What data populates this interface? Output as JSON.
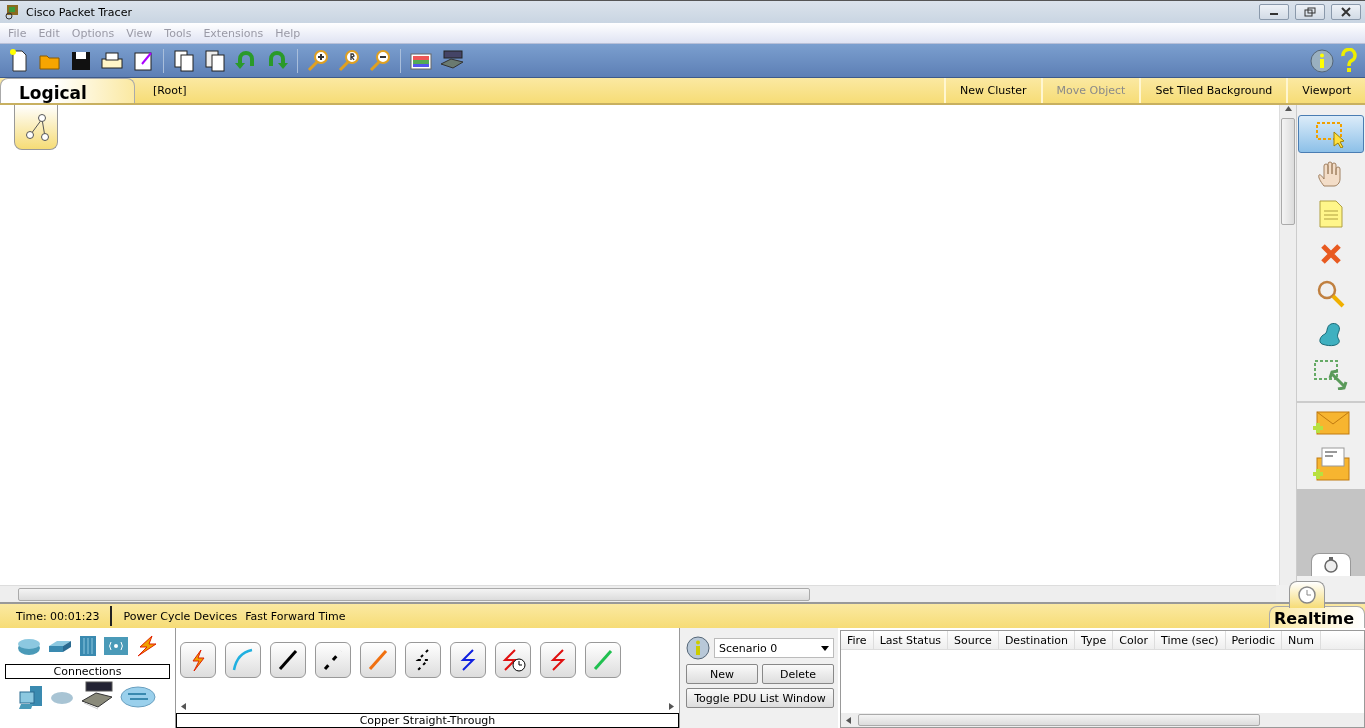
{
  "window": {
    "title": "Cisco Packet Tracer"
  },
  "menu": [
    "File",
    "Edit",
    "Options",
    "View",
    "Tools",
    "Extensions",
    "Help"
  ],
  "workspace_bar": {
    "tab": "Logical",
    "path": "[Root]",
    "actions": [
      {
        "label": "New Cluster",
        "disabled": false
      },
      {
        "label": "Move Object",
        "disabled": true
      },
      {
        "label": "Set Tiled Background",
        "disabled": false
      },
      {
        "label": "Viewport",
        "disabled": false
      }
    ]
  },
  "tools": [
    {
      "kind": "select",
      "selected": true
    },
    {
      "kind": "hand",
      "selected": false
    },
    {
      "kind": "note",
      "selected": false
    },
    {
      "kind": "delete",
      "selected": false
    },
    {
      "kind": "inspect",
      "selected": false
    },
    {
      "kind": "shape",
      "selected": false
    },
    {
      "kind": "resize",
      "selected": false
    },
    {
      "kind": "simple-pdu",
      "selected": false
    },
    {
      "kind": "complex-pdu",
      "selected": false
    }
  ],
  "status_bar": {
    "time": "Time: 00:01:23",
    "actions": [
      "Power Cycle Devices",
      "Fast Forward Time"
    ],
    "mode": "Realtime"
  },
  "device_panel": {
    "category": "Connections",
    "connection": "Copper Straight-Through",
    "cables": [
      {
        "kind": "auto",
        "selected": false
      },
      {
        "kind": "console",
        "selected": false
      },
      {
        "kind": "straight",
        "selected": false
      },
      {
        "kind": "cross",
        "selected": false
      },
      {
        "kind": "fiber",
        "selected": false
      },
      {
        "kind": "phone",
        "selected": false
      },
      {
        "kind": "coax",
        "selected": false
      },
      {
        "kind": "serial-dce",
        "selected": false
      },
      {
        "kind": "serial-dte",
        "selected": false
      },
      {
        "kind": "octal",
        "selected": false
      }
    ]
  },
  "scenario": {
    "value": "Scenario 0",
    "buttons": [
      "New",
      "Delete"
    ],
    "toggle": "Toggle PDU List Window"
  },
  "pdu_table": {
    "columns": [
      "Fire",
      "Last Status",
      "Source",
      "Destination",
      "Type",
      "Color",
      "Time (sec)",
      "Periodic",
      "Num"
    ]
  }
}
